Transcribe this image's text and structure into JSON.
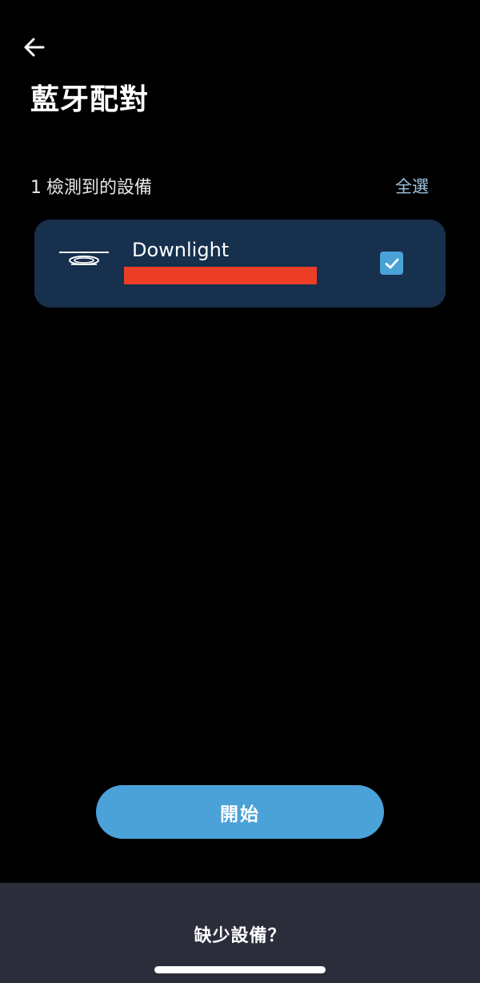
{
  "header": {
    "back_icon": "arrow-left-icon",
    "title": "藍牙配對"
  },
  "detection": {
    "count": "1",
    "label": "檢測到的設備",
    "select_all": "全選"
  },
  "devices": [
    {
      "icon": "downlight-icon",
      "name": "Downlight",
      "checked": true
    }
  ],
  "actions": {
    "start_label": "開始",
    "missing_label": "缺少設備？"
  },
  "colors": {
    "background": "#000000",
    "card": "#16304d",
    "accent": "#4aa2d8",
    "select_all": "#9cc4e4",
    "bottom_panel": "#2c2d3b",
    "redaction": "#ec3e27"
  }
}
